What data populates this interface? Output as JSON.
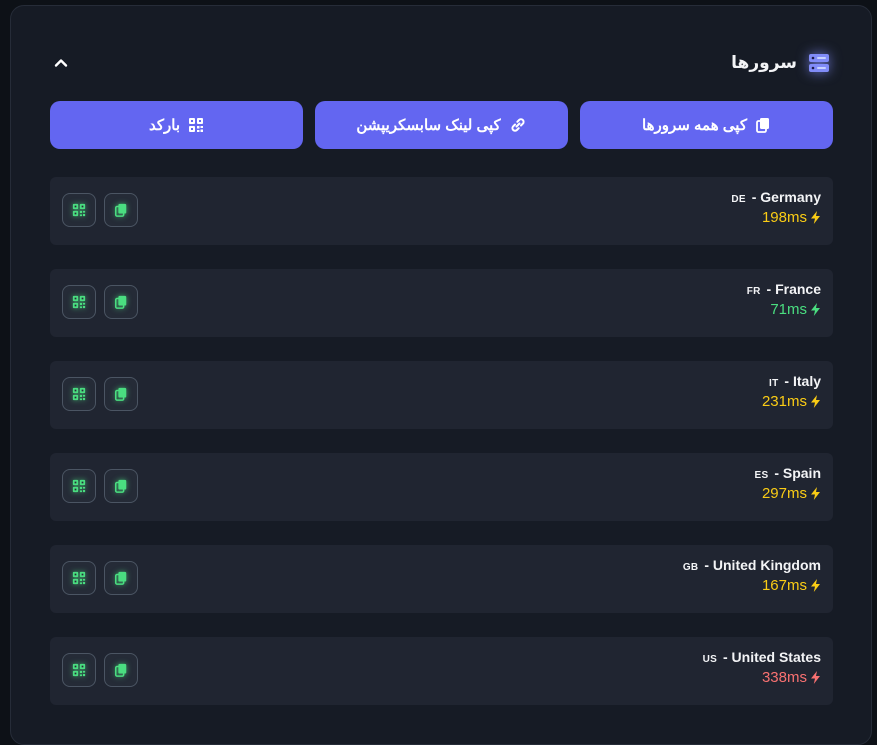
{
  "panel": {
    "title": "سرورها",
    "title_icon": "server-icon",
    "collapse_icon": "chevron-up-icon"
  },
  "actions": [
    {
      "label": "کپی همه سرورها",
      "icon": "copy-icon"
    },
    {
      "label": "کپی لینک سابسکریپشن",
      "icon": "link-icon"
    },
    {
      "label": "بارکد",
      "icon": "qr-code-icon"
    }
  ],
  "servers": [
    {
      "code": "DE",
      "country": "Germany",
      "ping": "198ms",
      "ping_status": "medium"
    },
    {
      "code": "FR",
      "country": "France",
      "ping": "71ms",
      "ping_status": "good"
    },
    {
      "code": "IT",
      "country": "Italy",
      "ping": "231ms",
      "ping_status": "medium"
    },
    {
      "code": "ES",
      "country": "Spain",
      "ping": "297ms",
      "ping_status": "medium"
    },
    {
      "code": "GB",
      "country": "United Kingdom",
      "ping": "167ms",
      "ping_status": "medium"
    },
    {
      "code": "US",
      "country": "United States",
      "ping": "338ms",
      "ping_status": "bad"
    }
  ],
  "server_row_icons": {
    "qr": "qr-code-icon",
    "copy": "copy-icon",
    "ping": "lightning-icon"
  },
  "colors": {
    "accent": "#6366f1",
    "ping_good": "#4ade80",
    "ping_medium": "#facc15",
    "ping_bad": "#f87171",
    "icon_green": "#4ade80"
  }
}
